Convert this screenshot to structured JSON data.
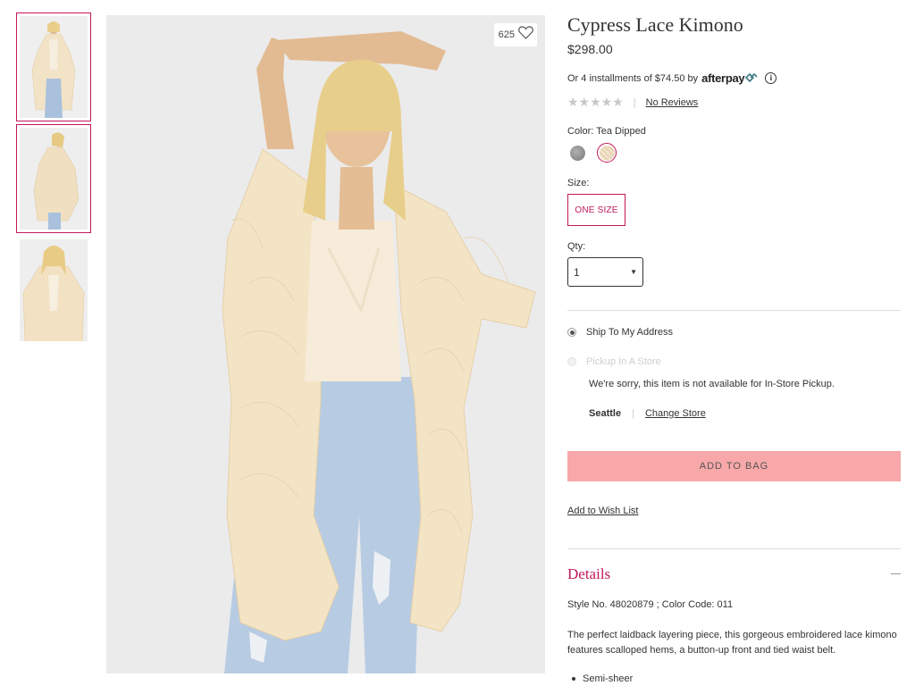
{
  "product": {
    "title": "Cypress Lace Kimono",
    "price": "$298.00",
    "like_count": "625"
  },
  "installments": {
    "text": "Or 4 installments of $74.50 by",
    "provider": "afterpay"
  },
  "rating": {
    "stars": "★★★★★",
    "stars_filled": 0,
    "reviews_link": "No Reviews"
  },
  "color": {
    "label": "Color: Tea Dipped",
    "swatches": [
      {
        "name": "grey",
        "color": "#8f8f8f"
      },
      {
        "name": "tea dipped",
        "color": "#eedcc4",
        "selected": true
      }
    ]
  },
  "size": {
    "label": "Size:",
    "selected": "ONE SIZE"
  },
  "qty": {
    "label": "Qty:",
    "value": "1"
  },
  "shipping": {
    "ship_option": "Ship To My Address",
    "pickup_option": "Pickup In A Store",
    "pickup_note": "We're sorry, this item is not available for In-Store Pickup.",
    "store_name": "Seattle",
    "change_store": "Change Store"
  },
  "actions": {
    "add_to_bag": "ADD TO BAG",
    "wishlist": "Add to Wish List"
  },
  "details": {
    "title": "Details",
    "style_no": "Style No. 48020879 ; Color Code: 011",
    "description": "The perfect laidback layering piece, this gorgeous embroidered lace kimono features scalloped hems, a button-up front and tied waist belt.",
    "bullets": [
      "Semi-sheer"
    ]
  },
  "colors": {
    "accent": "#c2185b",
    "add_to_bag_bg": "#f8a8a9",
    "afterpay_mark": "#3d7a86"
  },
  "thumbnails": [
    {
      "name": "front view",
      "selected": true
    },
    {
      "name": "side view",
      "selected": true
    },
    {
      "name": "close-up view",
      "selected": false
    }
  ]
}
